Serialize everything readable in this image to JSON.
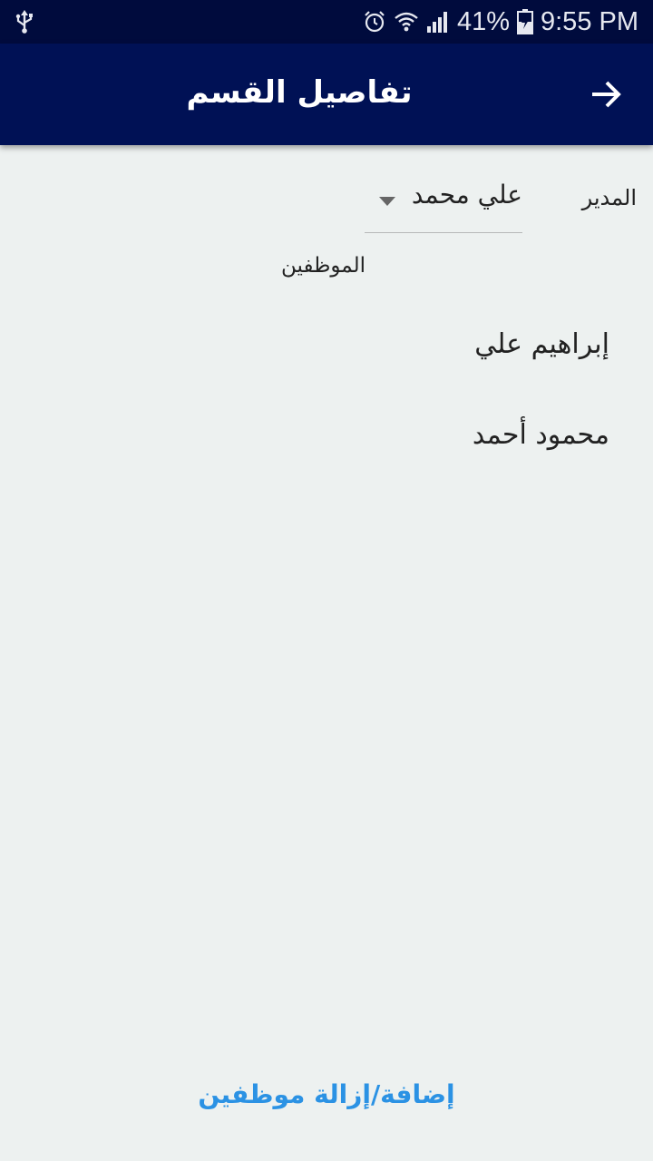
{
  "status_bar": {
    "battery_percent": "41%",
    "time": "9:55 PM",
    "icons": [
      "usb-icon",
      "alarm-icon",
      "wifi-icon",
      "signal-icon",
      "battery-charging-icon"
    ]
  },
  "app_bar": {
    "title": "تفاصيل القسم",
    "back_icon": "arrow-right-icon"
  },
  "form": {
    "manager_label": "المدير",
    "manager_value": "علي محمد",
    "employees_label": "الموظفين",
    "employees": [
      "إبراهيم علي",
      "محمود أحمد"
    ]
  },
  "footer": {
    "add_remove_label": "إضافة/إزالة موظفين"
  },
  "colors": {
    "status_bar": "#000b3d",
    "app_bar": "#001155",
    "background": "#edf1f0",
    "link": "#2b92e4"
  }
}
